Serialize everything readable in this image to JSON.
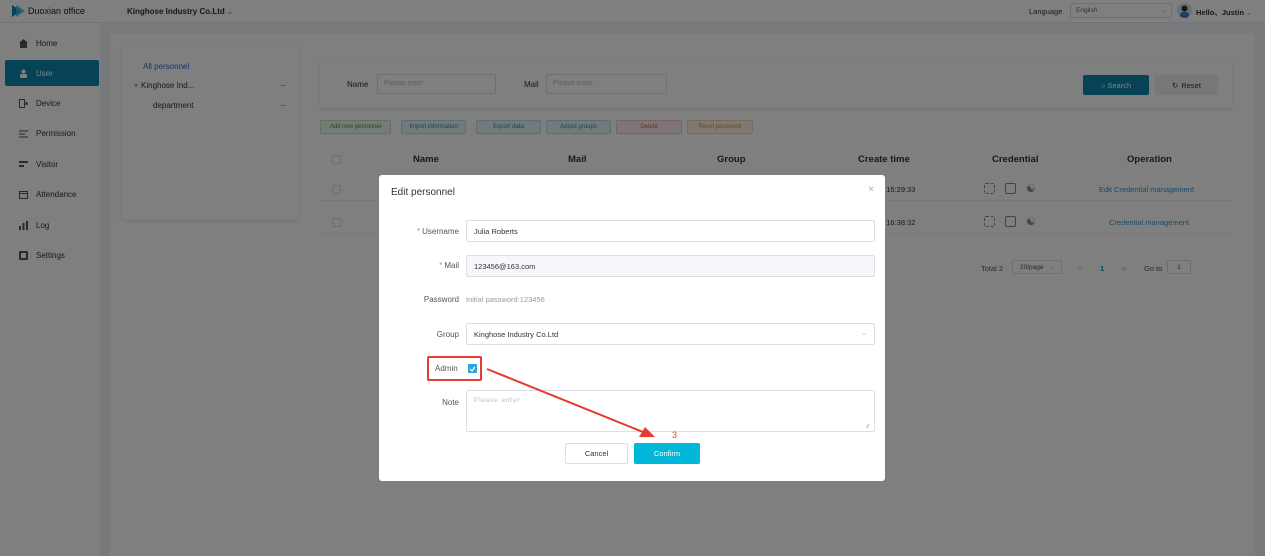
{
  "topbar": {
    "app_name": "Duoxian office",
    "company": "Kinghose Industry Co.Ltd",
    "language_label": "Language",
    "language_value": "English",
    "greeting": "Hello、Justin"
  },
  "sidebar": {
    "items": [
      {
        "label": "Home",
        "icon": "home-icon"
      },
      {
        "label": "User",
        "icon": "user-icon",
        "active": true
      },
      {
        "label": "Device",
        "icon": "device-icon"
      },
      {
        "label": "Permission",
        "icon": "permission-icon"
      },
      {
        "label": "Visitor",
        "icon": "visitor-icon"
      },
      {
        "label": "Attendance",
        "icon": "calendar-icon"
      },
      {
        "label": "Log",
        "icon": "log-icon"
      },
      {
        "label": "Settings",
        "icon": "settings-icon"
      }
    ],
    "active_color": "#0e86ac"
  },
  "tree": {
    "all": "All personnel",
    "nodes": [
      "Kinghose Ind...",
      "department"
    ],
    "more": "···"
  },
  "search": {
    "name_label": "Name",
    "name_placeholder": "Please enter",
    "mail_label": "Mail",
    "mail_placeholder": "Please enter",
    "search_btn": "Search",
    "reset_btn": "Reset"
  },
  "actions": [
    {
      "label": "Add new personnel",
      "bg": "#eaf6ea",
      "border": "#bfe3bf",
      "color": "#3c9a3c"
    },
    {
      "label": "Import information",
      "bg": "#e6f4f9",
      "border": "#b6dcec",
      "color": "#2a8ab5"
    },
    {
      "label": "Export data",
      "bg": "#e6f4f9",
      "border": "#b6dcec",
      "color": "#2a8ab5"
    },
    {
      "label": "Adjust groups",
      "bg": "#e6f4f9",
      "border": "#b6dcec",
      "color": "#2a8ab5"
    },
    {
      "label": "Delete",
      "bg": "#fdecec",
      "border": "#f7c3c3",
      "color": "#e05a5a"
    },
    {
      "label": "Reset password",
      "bg": "#fdf3e6",
      "border": "#f5d7a8",
      "color": "#d99030"
    }
  ],
  "table": {
    "headers": [
      "Name",
      "Mail",
      "Group",
      "Create time",
      "Credential",
      "Operation"
    ],
    "rows": [
      {
        "create_time": "3 15:29:33",
        "operation": "Edit  Credential management"
      },
      {
        "create_time": "3 16:38:32",
        "operation": "Credential management"
      }
    ]
  },
  "pagination": {
    "total": "Total 2",
    "page_size": "20/page",
    "prev": "<",
    "current": "1",
    "next": ">",
    "goto_label": "Go to",
    "goto_value": "1"
  },
  "dialog": {
    "title": "Edit personnel",
    "close": "×",
    "username_label": "Username",
    "username_value": "Julia Roberts",
    "mail_label": "Mail",
    "mail_value": "123456@163.com",
    "password_label": "Password",
    "password_value": "Initial password:123456",
    "group_label": "Group",
    "group_value": "Kinghose Industry Co.Ltd",
    "admin_label": "Admin",
    "admin_checked": true,
    "note_label": "Note",
    "note_placeholder": "Please enter",
    "cancel_btn": "Cancel",
    "confirm_btn": "Confirm",
    "step_number": "3",
    "annotation_color": "#e63a32"
  }
}
